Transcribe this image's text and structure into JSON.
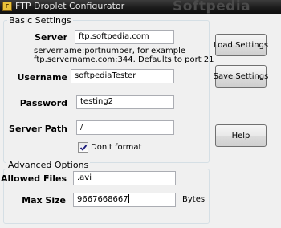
{
  "window": {
    "title": "FTP Droplet Configurator",
    "watermark": "Softpedia"
  },
  "basic": {
    "legend": "Basic Settings",
    "server": {
      "label": "Server",
      "value": "ftp.softpedia.com"
    },
    "server_hint_line1": "servername:portnumber, for example",
    "server_hint_line2": "ftp.servername.com:344. Defaults to port 21",
    "username": {
      "label": "Username",
      "value": "softpediaTester"
    },
    "password": {
      "label": "Password",
      "value": "testing2"
    },
    "server_path": {
      "label": "Server Path",
      "value": "/"
    },
    "dont_format": {
      "label": "Don't format",
      "checked": true
    }
  },
  "advanced": {
    "legend": "Advanced Options",
    "allowed_files": {
      "label": "Allowed Files",
      "value": ".avi"
    },
    "max_size": {
      "label": "Max Size",
      "value": "9667668667",
      "unit": "Bytes"
    }
  },
  "buttons": {
    "load": "Load Settings",
    "save": "Save Settings",
    "help": "Help"
  }
}
